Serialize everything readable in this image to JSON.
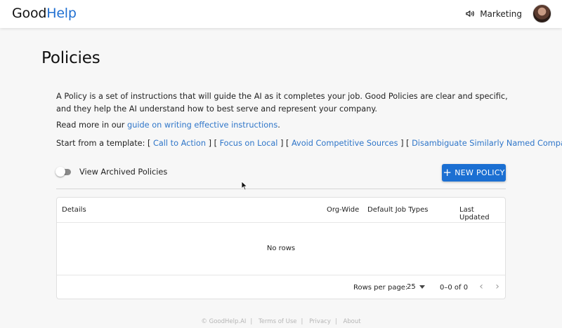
{
  "header": {
    "logo_part1": "Good",
    "logo_part2": "Help",
    "org_name": "Marketing",
    "brand_color": "#1f6fd1",
    "org_icon": "megaphone-icon"
  },
  "page": {
    "title": "Policies",
    "description": "A Policy is a set of instructions that will guide the AI as it completes your job. Good Policies are clear and specific, and they help the AI understand how to best serve and represent your company.",
    "read_more_prefix": "Read more in our ",
    "read_more_link": "guide on writing effective instructions",
    "read_more_suffix": ".",
    "templates_prefix": "Start from a template: ",
    "templates": [
      "Call to Action",
      "Focus on Local",
      "Avoid Competitive Sources",
      "Disambiguate Similarly Named Company"
    ],
    "toggle_label": "View Archived Policies",
    "toggle_on": false,
    "new_button_label": "NEW POLICY",
    "accent_color": "#1b6fd2"
  },
  "table": {
    "columns": [
      "Details",
      "Org-Wide",
      "Default Job Types",
      "Last Updated"
    ],
    "empty_text": "No rows",
    "rows_per_page_label": "Rows per page:",
    "rows_per_page_value": "25",
    "range_text": "0–0 of 0"
  },
  "footer": {
    "copyright": "© GoodHelp.AI",
    "links": [
      "Terms of Use",
      "Privacy",
      "About"
    ]
  }
}
